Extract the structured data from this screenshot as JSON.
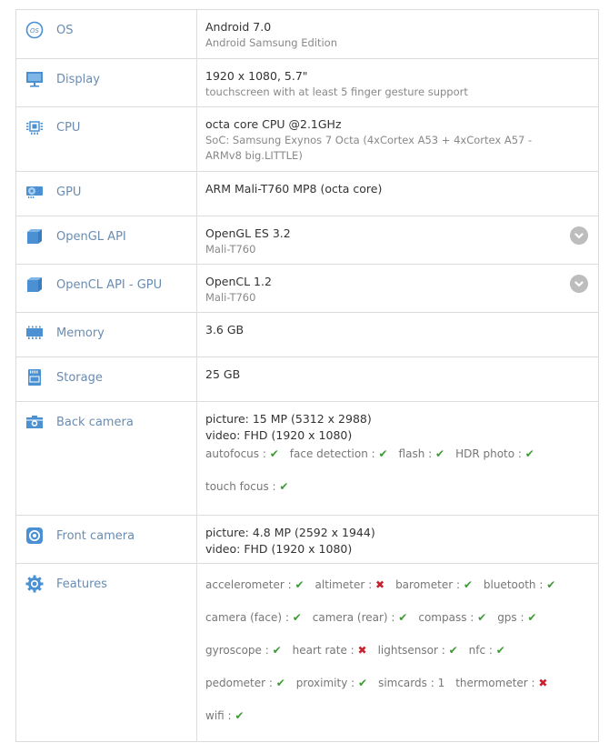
{
  "colors": {
    "accent": "#4a90d2",
    "label": "#6a8cb1",
    "ok": "#3d9a35",
    "no": "#c8202c"
  },
  "rows": {
    "os": {
      "label": "OS",
      "main": "Android 7.0",
      "sub": "Android Samsung Edition",
      "icon": "os-icon"
    },
    "display": {
      "label": "Display",
      "main": "1920 x 1080, 5.7\"",
      "sub": "touchscreen with at least 5 finger gesture support",
      "icon": "monitor-icon"
    },
    "cpu": {
      "label": "CPU",
      "main": "octa core CPU @2.1GHz",
      "sub": "SoC: Samsung Exynos 7 Octa (4xCortex A53 + 4xCortex A57 - ARMv8 big.LITTLE)",
      "icon": "cpu-chip-icon"
    },
    "gpu": {
      "label": "GPU",
      "main": "ARM Mali-T760 MP8 (octa core)",
      "icon": "gpu-card-icon"
    },
    "opengl": {
      "label": "OpenGL API",
      "main": "OpenGL ES 3.2",
      "sub": "Mali-T760",
      "icon": "cube-icon"
    },
    "opencl": {
      "label": "OpenCL API - GPU",
      "main": "OpenCL 1.2",
      "sub": "Mali-T760",
      "icon": "cube-icon"
    },
    "memory": {
      "label": "Memory",
      "main": "3.6 GB",
      "icon": "memory-icon"
    },
    "storage": {
      "label": "Storage",
      "main": "25 GB",
      "icon": "sd-card-icon"
    },
    "back_camera": {
      "label": "Back camera",
      "picture": "picture: 15 MP (5312 x 2988)",
      "video": "video: FHD (1920 x 1080)",
      "features": [
        {
          "name": "autofocus :",
          "status": "yes"
        },
        {
          "name": "face detection :",
          "status": "yes"
        },
        {
          "name": "flash :",
          "status": "yes"
        },
        {
          "name": "HDR photo :",
          "status": "yes"
        },
        {
          "name": "touch focus :",
          "status": "yes"
        }
      ],
      "icon": "camera-icon"
    },
    "front_camera": {
      "label": "Front camera",
      "picture": "picture: 4.8 MP (2592 x 1944)",
      "video": "video: FHD (1920 x 1080)",
      "icon": "front-camera-icon"
    },
    "features": {
      "label": "Features",
      "icon": "gear-icon",
      "items": [
        {
          "name": "accelerometer :",
          "status": "yes"
        },
        {
          "name": "altimeter :",
          "status": "no"
        },
        {
          "name": "barometer :",
          "status": "yes"
        },
        {
          "name": "bluetooth :",
          "status": "yes"
        },
        {
          "name": "camera (face) :",
          "status": "yes"
        },
        {
          "name": "camera (rear) :",
          "status": "yes"
        },
        {
          "name": "compass :",
          "status": "yes"
        },
        {
          "name": "gps :",
          "status": "yes"
        },
        {
          "name": "gyroscope :",
          "status": "yes"
        },
        {
          "name": "heart rate :",
          "status": "no"
        },
        {
          "name": "lightsensor :",
          "status": "yes"
        },
        {
          "name": "nfc :",
          "status": "yes"
        },
        {
          "name": "pedometer :",
          "status": "yes"
        },
        {
          "name": "proximity :",
          "status": "yes"
        },
        {
          "name": "simcards :",
          "value": "1"
        },
        {
          "name": "thermometer :",
          "status": "no"
        },
        {
          "name": "wifi :",
          "status": "yes"
        }
      ]
    }
  },
  "symbols": {
    "yes": "✔",
    "no": "✖"
  }
}
